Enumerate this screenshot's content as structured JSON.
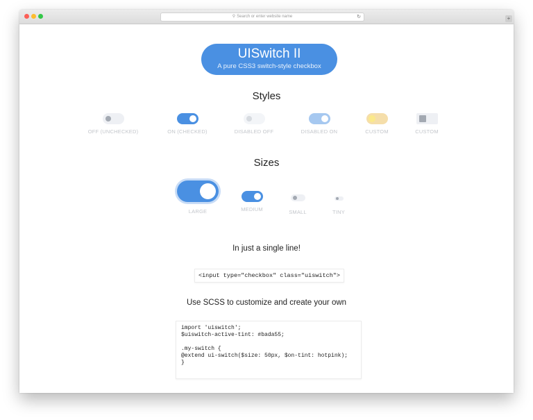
{
  "browser": {
    "url_placeholder": "Search or enter website name"
  },
  "hero": {
    "title": "UISwitch II",
    "subtitle": "A pure CSS3 switch-style checkbox"
  },
  "styles": {
    "heading": "Styles",
    "items": [
      {
        "label": "OFF (UNCHECKED)",
        "checked": false
      },
      {
        "label": "ON (CHECKED)",
        "checked": true
      },
      {
        "label": "DISABLED OFF",
        "checked": false,
        "disabled": true
      },
      {
        "label": "DISABLED ON",
        "checked": true,
        "disabled": true
      },
      {
        "label": "CUSTOM",
        "checked": false
      },
      {
        "label": "CUSTOM",
        "checked": false
      }
    ]
  },
  "sizes": {
    "heading": "Sizes",
    "items": [
      {
        "label": "LARGE",
        "checked": true
      },
      {
        "label": "MEDIUM",
        "checked": true
      },
      {
        "label": "SMALL",
        "checked": false
      },
      {
        "label": "TINY",
        "checked": false
      }
    ]
  },
  "single_line": {
    "heading": "In just a single line!",
    "code": "<input type=\"checkbox\" class=\"uiswitch\">"
  },
  "scss": {
    "heading": "Use SCSS to customize and create your own",
    "lines": [
      "import 'uiswitch';",
      "$uiswitch-active-tint: #bada55;",
      "",
      ".my-switch {",
      "@extend ui-switch($size: 50px, $on-tint: hotpink);",
      "}"
    ]
  },
  "colors": {
    "accent": "#4a90e2",
    "custom_tint": "#f5deaa"
  }
}
